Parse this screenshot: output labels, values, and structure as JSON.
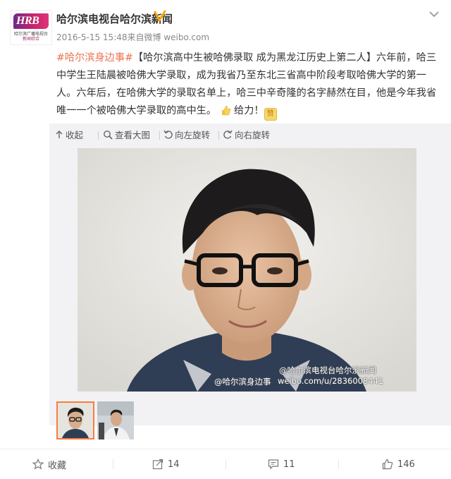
{
  "account": {
    "name": "哈尔滨电视台哈尔滨新闻",
    "logo_text": "HRB",
    "logo_sub_line1": "哈尔滨广播电视台",
    "logo_sub_line2": "新闻综合",
    "meta": "2016-5-15 15:48来自微博 weibo.com"
  },
  "post": {
    "hashtag": "#哈尔滨身边事#",
    "body": "【哈尔滨高中生被哈佛录取 成为黑龙江历史上第二人】六年前，哈三中学生王陆晨被哈佛大学录取，成为我省乃至东北三省高中阶段考取哈佛大学的第一人。六年后，在哈佛大学的录取名单上，哈三中辛奇隆的名字赫然在目，他是今年我省唯一一个被哈佛大学录取的高中生。",
    "tail": "给力！",
    "zan": "赞"
  },
  "toolbar": {
    "collapse": "收起",
    "view_large": "查看大图",
    "rotate_left": "向左旋转",
    "rotate_right": "向右旋转"
  },
  "watermarks": {
    "account": "@哈尔滨电视台哈尔滨新闻",
    "tag": "@哈尔滨身边事",
    "url": "weibo.com/u/2836008441"
  },
  "footer": {
    "favorite": "收藏",
    "repost": "14",
    "comment": "11",
    "like": "146"
  },
  "colors": {
    "link": "#eb7350",
    "selected_border": "#fa7d3c",
    "verified": "#ffa500"
  }
}
